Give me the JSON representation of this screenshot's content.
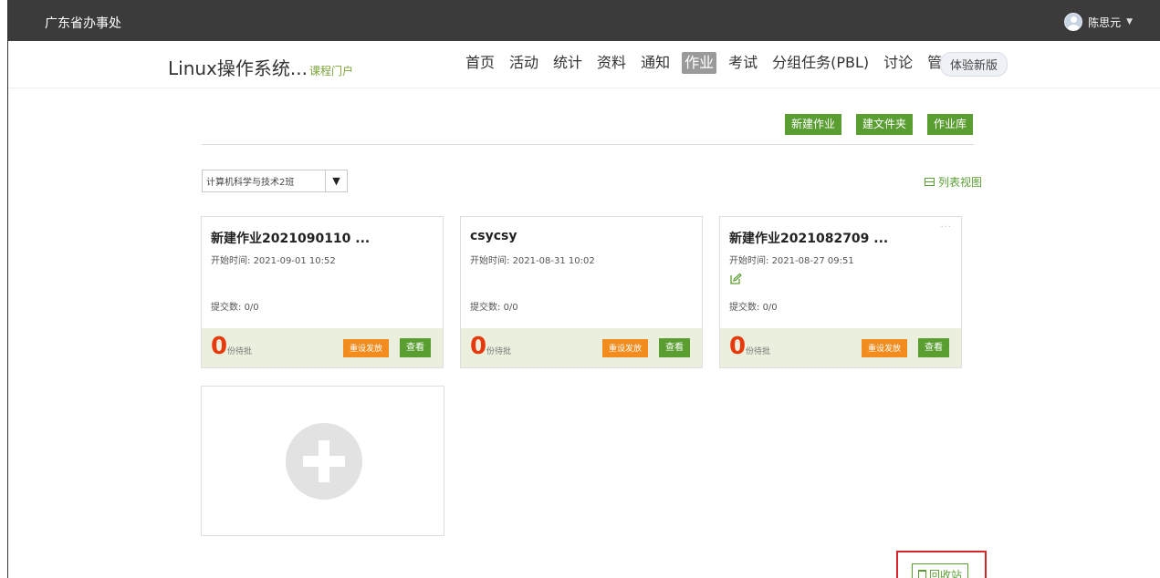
{
  "topbar": {
    "org_name": "广东省办事处",
    "user_name": "陈思元"
  },
  "course": {
    "title": "Linux操作系统...",
    "portal_label": "课程门户"
  },
  "nav": {
    "items": [
      "首页",
      "活动",
      "统计",
      "资料",
      "通知",
      "作业",
      "考试",
      "分组任务(PBL)",
      "讨论",
      "管理"
    ],
    "active": "作业",
    "try_new_label": "体验新版"
  },
  "toolbar": {
    "new_homework": "新建作业",
    "new_folder": "建文件夹",
    "homework_bank": "作业库"
  },
  "class_select": {
    "value": "计算机科学与技术2班"
  },
  "list_view_label": "列表视图",
  "cards": [
    {
      "title": "新建作业2021090110 ...",
      "start_label": "开始时间:",
      "start_time": "2021-09-01 10:52",
      "submit_label": "提交数:",
      "submit_count": "0/0",
      "pending_count": "0",
      "pending_label": "份待批",
      "reset_label": "重设发放",
      "view_label": "查看"
    },
    {
      "title": "csycsy",
      "start_label": "开始时间:",
      "start_time": "2021-08-31 10:02",
      "submit_label": "提交数:",
      "submit_count": "0/0",
      "pending_count": "0",
      "pending_label": "份待批",
      "reset_label": "重设发放",
      "view_label": "查看"
    },
    {
      "title": "新建作业2021082709 ...",
      "start_label": "开始时间:",
      "start_time": "2021-08-27 09:51",
      "submit_label": "提交数:",
      "submit_count": "0/0",
      "pending_count": "0",
      "pending_label": "份待批",
      "reset_label": "重设发放",
      "view_label": "查看",
      "more_label": "···"
    }
  ],
  "recycle_label": "回收站",
  "colors": {
    "accent_green": "#5a9e32",
    "orange": "#f28c1e",
    "pending_red": "#e8380d",
    "highlight_red": "#d9242a",
    "topbar": "#3b3b3b"
  }
}
